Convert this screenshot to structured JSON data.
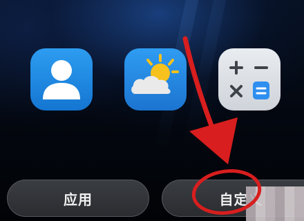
{
  "icons": {
    "contacts": "person-icon",
    "weather": "weather-icon",
    "calculator": "calculator-icon"
  },
  "buttons": {
    "apps_label": "应用",
    "custom_label": "自定义"
  },
  "colors": {
    "annotation_red": "#d81e1e",
    "icon_blue": "#1f86e0",
    "pill_bg": "#303237"
  }
}
